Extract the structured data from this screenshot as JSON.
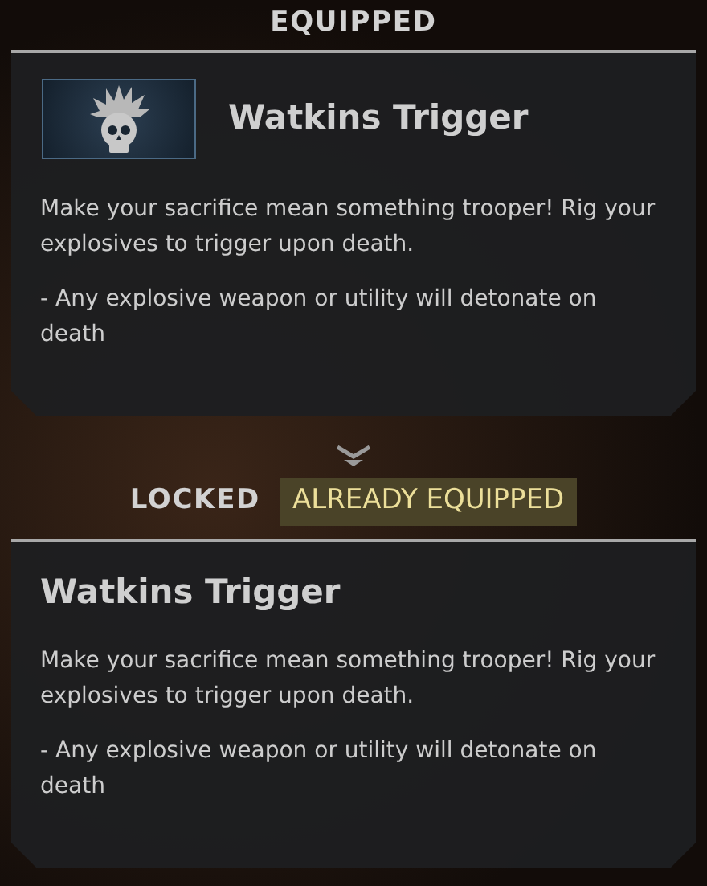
{
  "equipped": {
    "heading": "EQUIPPED",
    "perk": {
      "title": "Watkins Trigger",
      "paragraphs": [
        "Make your sacrifice mean something trooper! Rig your explosives to trigger upon death.",
        "- Any explosive weapon or utility will detonate on death"
      ]
    }
  },
  "preview": {
    "heading": "LOCKED",
    "badge": "ALREADY EQUIPPED",
    "perk": {
      "title": "Watkins Trigger",
      "paragraphs": [
        "Make your sacrifice mean something trooper! Rig your explosives to trigger upon death.",
        "- Any explosive weapon or utility will detonate on death"
      ]
    }
  }
}
